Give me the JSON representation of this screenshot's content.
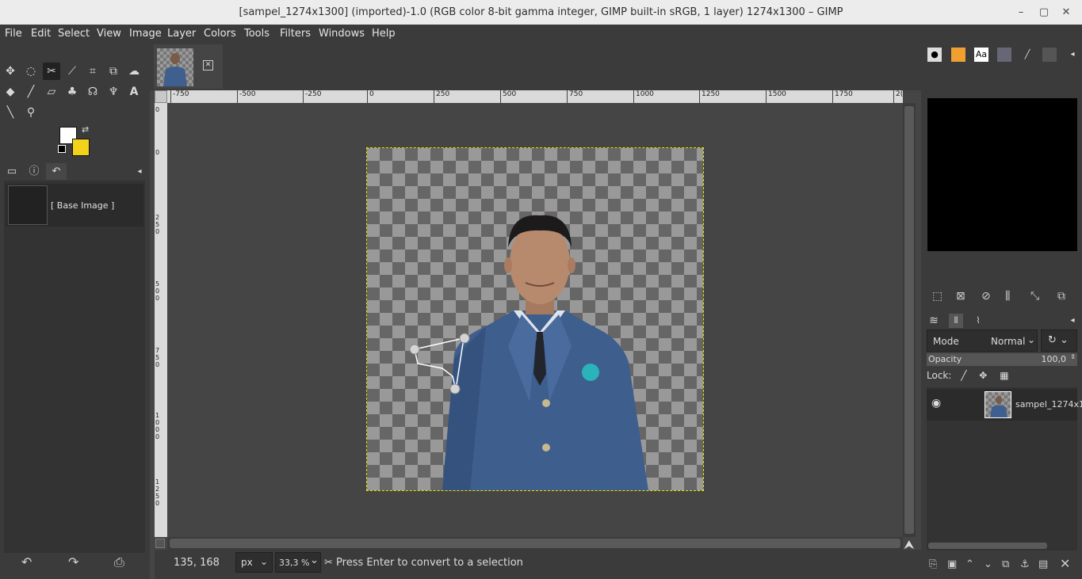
{
  "window": {
    "title": "[sampel_1274x1300] (imported)-1.0 (RGB color 8-bit gamma integer, GIMP built-in sRGB, 1 layer) 1274x1300 – GIMP"
  },
  "menu": [
    "File",
    "Edit",
    "Select",
    "View",
    "Image",
    "Layer",
    "Colors",
    "Tools",
    "Filters",
    "Windows",
    "Help"
  ],
  "toolbox": {
    "tools": [
      "move",
      "ellipse-select",
      "scissors-select",
      "fuzzy-select",
      "crop",
      "unified-transform",
      "warp",
      "bucket-fill",
      "paintbrush",
      "eraser",
      "clone",
      "smudge",
      "paths",
      "text",
      "color-picker",
      "zoom"
    ],
    "active_tool": "scissors-select",
    "fg_color": "#ffffff",
    "bg_color": "#f2d31a"
  },
  "left_panel": {
    "tabs": [
      "device-status",
      "image-info",
      "undo-history"
    ],
    "undo_item": "[ Base Image ]"
  },
  "image_tab": {
    "name": "sampel_1274x1300"
  },
  "rulers": {
    "horizontal": [
      "-750",
      "-500",
      "-250",
      "0",
      "250",
      "500",
      "750",
      "1000",
      "1250",
      "1500",
      "1750",
      "2("
    ],
    "vertical": [
      "0",
      "0",
      "250",
      "500",
      "750",
      "1000",
      "1250"
    ]
  },
  "status": {
    "coords": "135, 168",
    "unit": "px",
    "zoom": "33,3 %",
    "message": "Press Enter to convert to a selection"
  },
  "layers_panel": {
    "mode_label": "Mode",
    "mode_value": "Normal",
    "opacity_label": "Opacity",
    "opacity_value": "100,0",
    "opacity_fraction": 1.0,
    "lock_label": "Lock:",
    "layer_name": "sampel_1274x1"
  }
}
